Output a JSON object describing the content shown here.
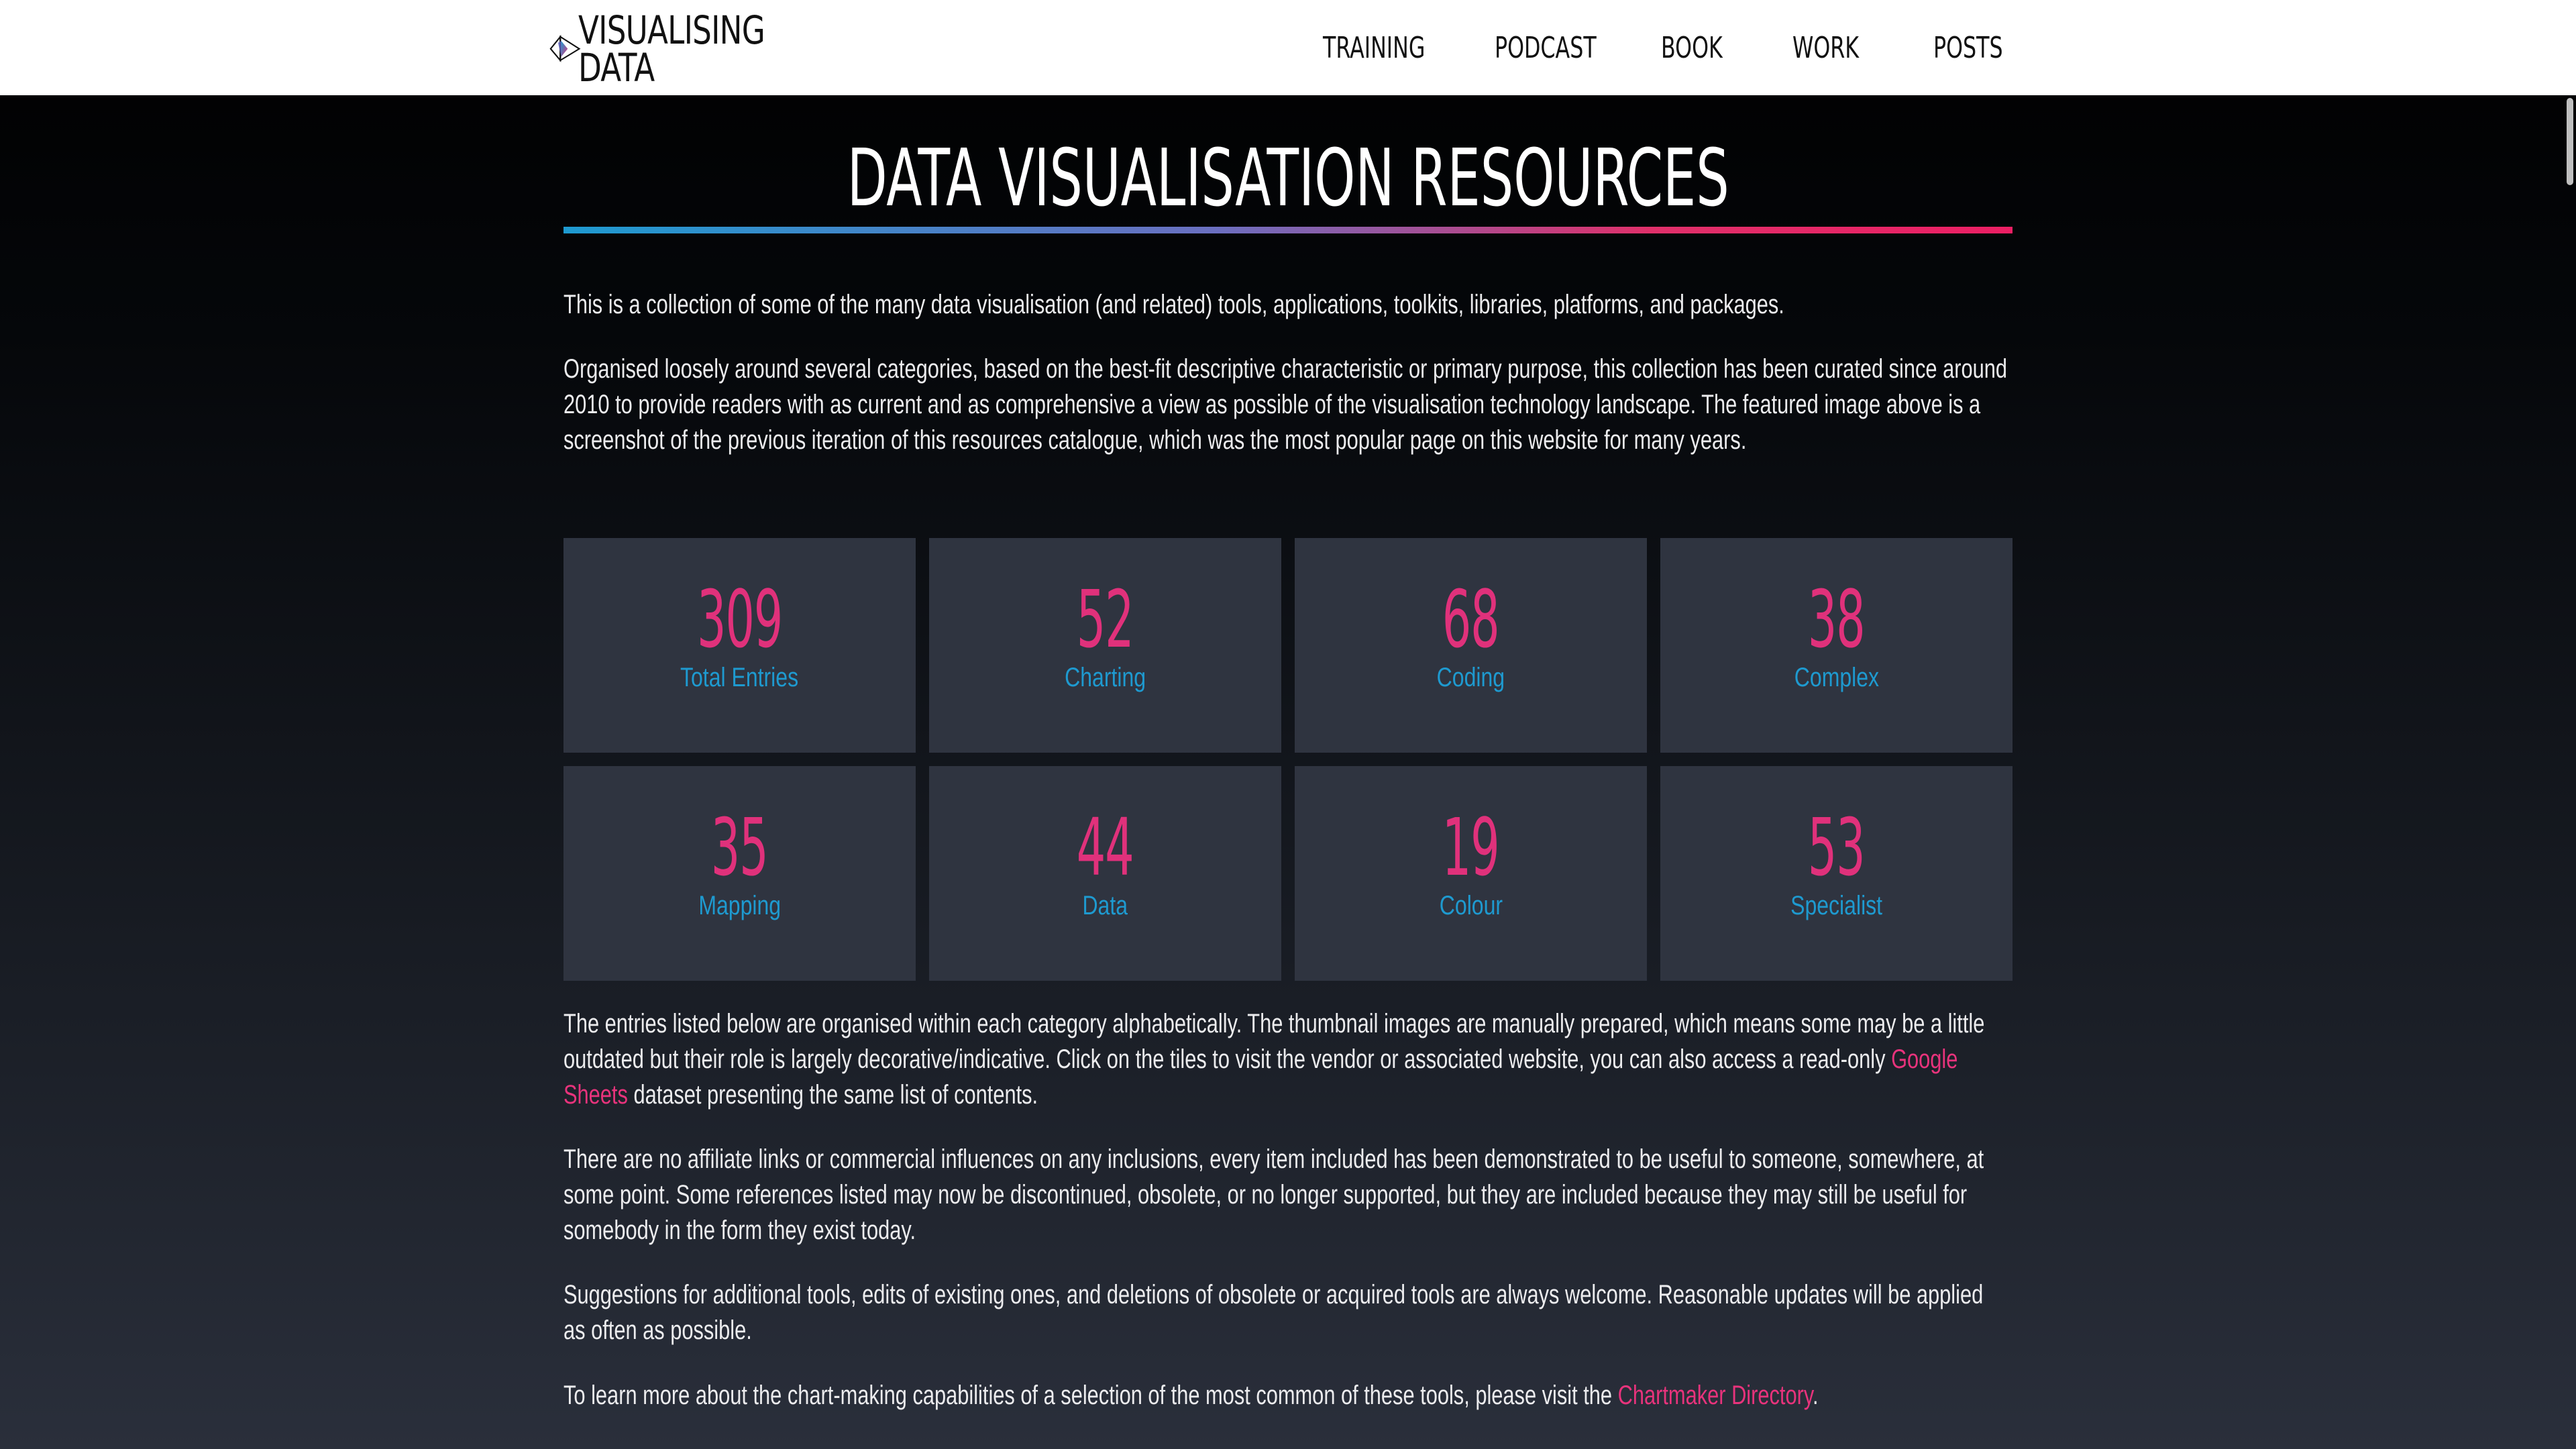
{
  "header": {
    "logo_line1": "VISUALISING",
    "logo_line2": "DATA",
    "nav": [
      "TRAINING",
      "PODCAST",
      "BOOK",
      "WORK",
      "POSTS"
    ]
  },
  "page_title": "DATA VISUALISATION RESOURCES",
  "intro": {
    "p1": "This is a collection of some of the many data visualisation (and related) tools, applications, toolkits, libraries, platforms, and packages.",
    "p2": "Organised loosely around several categories, based on the best-fit descriptive characteristic or primary purpose, this collection has been curated since around 2010 to provide readers with as current and as comprehensive a view as possible of the visualisation technology landscape. The featured image above is a screenshot of the previous iteration of this resources catalogue, which was the most popular page on this website for many years."
  },
  "tiles": [
    {
      "count": "309",
      "label": "Total Entries"
    },
    {
      "count": "52",
      "label": "Charting"
    },
    {
      "count": "68",
      "label": "Coding"
    },
    {
      "count": "38",
      "label": "Complex"
    },
    {
      "count": "35",
      "label": "Mapping"
    },
    {
      "count": "44",
      "label": "Data"
    },
    {
      "count": "19",
      "label": "Colour"
    },
    {
      "count": "53",
      "label": "Specialist"
    }
  ],
  "body": {
    "p3_before": "The entries listed below are organised within each category alphabetically. The thumbnail images are manually prepared, which means some may be a little outdated but their role is largely decorative/indicative. Click on the tiles to visit the vendor or associated website, you can also access a read-only ",
    "p3_link": "Google Sheets",
    "p3_after": " dataset presenting the same list of contents.",
    "p4": "There are no affiliate links or commercial influences on any inclusions, every item included has been demonstrated to be useful to someone, somewhere, at some point. Some references listed may now be discontinued, obsolete, or no longer supported, but they are included because they may still be useful for somebody in the form they exist today.",
    "p5": "Suggestions for additional tools, edits of existing ones, and deletions of obsolete or acquired tools are always welcome. Reasonable updates will be applied as often as possible.",
    "p6_before": "To learn more about the chart-making capabilities of a selection of the most common of these tools, please visit the ",
    "p6_link": "Chartmaker Directory",
    "p6_after": "."
  },
  "colors": {
    "accent_pink": "#e0317b",
    "accent_blue": "#1e9ad0",
    "tile_bg": "#2f3440"
  }
}
